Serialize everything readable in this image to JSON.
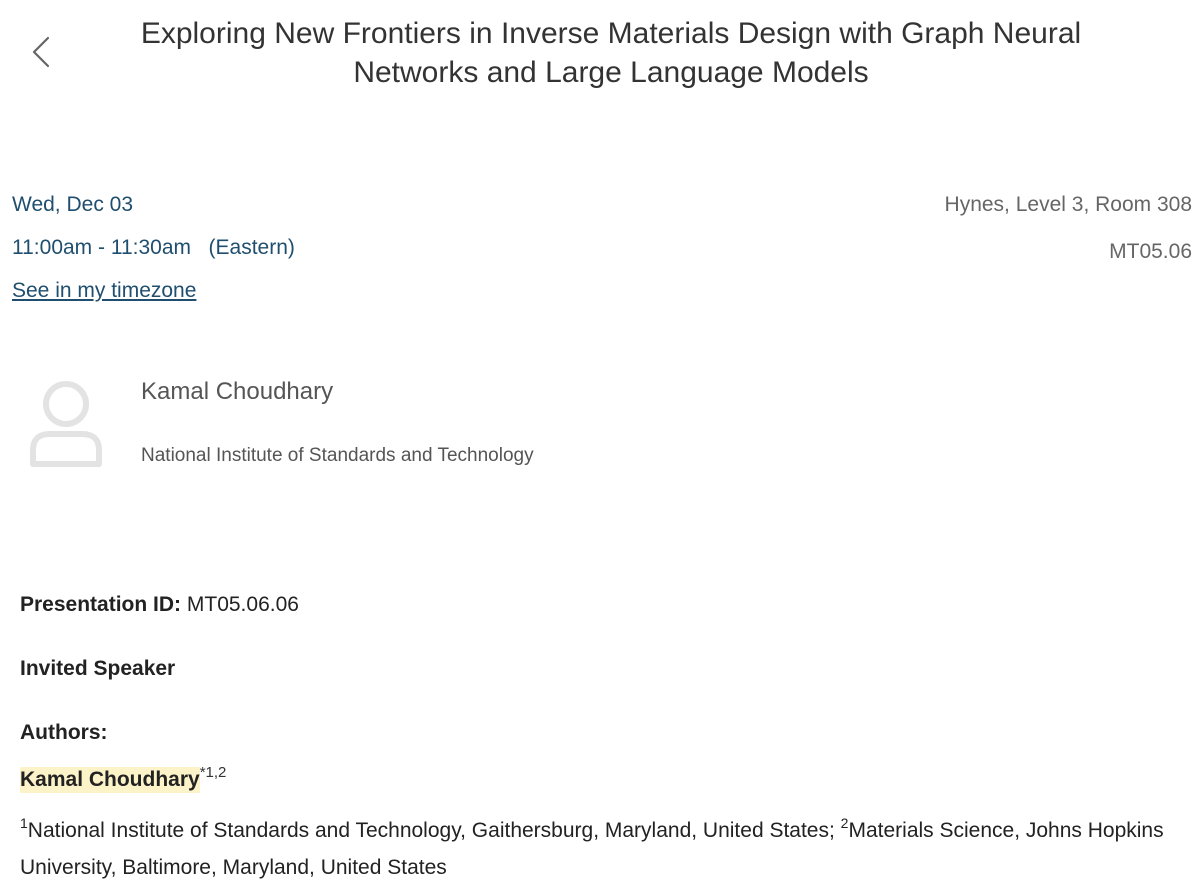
{
  "header": {
    "back_icon": "chevron-left-icon",
    "title": "Exploring New Frontiers in Inverse Materials Design with Graph Neural Networks and Large Language Models"
  },
  "session": {
    "date": "Wed, Dec 03",
    "time": "11:00am - 11:30am",
    "timezone": "(Eastern)",
    "timezone_link": "See in my timezone",
    "location": "Hynes, Level 3, Room 308",
    "code": "MT05.06"
  },
  "speaker": {
    "avatar_icon": "user-placeholder-icon",
    "name": "Kamal Choudhary",
    "affiliation": "National Institute of Standards and Technology"
  },
  "presentation": {
    "id_label": "Presentation ID:",
    "id_value": "MT05.06.06",
    "type": "Invited Speaker",
    "authors_label": "Authors:",
    "authors": [
      {
        "name": "Kamal Choudhary",
        "marks": "*",
        "affiliation_refs": "1,2"
      }
    ],
    "affiliations": [
      {
        "ref": "1",
        "text": "National Institute of Standards and Technology, Gaithersburg, Maryland, United States;"
      },
      {
        "ref": "2",
        "text": "Materials Science, Johns Hopkins University, Baltimore, Maryland, United States"
      }
    ]
  },
  "colors": {
    "link": "#1f4e6e",
    "highlight": "#fdf3c9",
    "muted_text": "#666666"
  }
}
